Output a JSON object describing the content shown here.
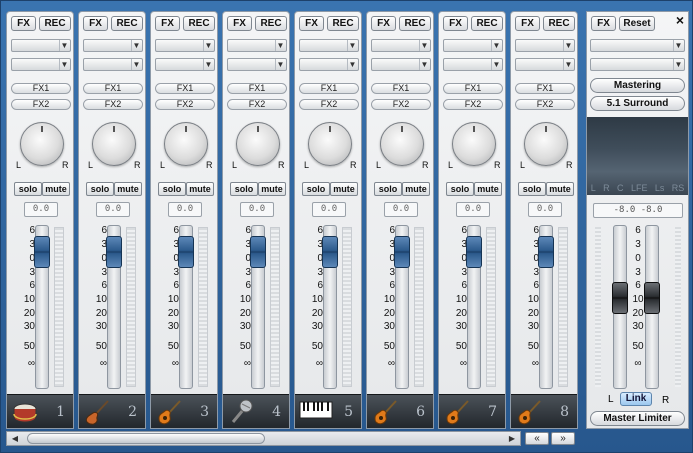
{
  "strip": {
    "fx_label": "FX",
    "rec_label": "REC",
    "fx1_label": "FX1",
    "fx2_label": "FX2",
    "pan_left": "L",
    "pan_right": "R",
    "solo_label": "solo",
    "mute_label": "mute",
    "gain_value": "0.0",
    "scale": [
      "6",
      "3",
      "0",
      "3",
      "6",
      "10",
      "20",
      "30",
      "50",
      "∞"
    ]
  },
  "channels": [
    {
      "number": "1",
      "instrument": "drum-icon",
      "fader_level_db": 0
    },
    {
      "number": "2",
      "instrument": "electric-guitar-icon",
      "fader_level_db": 0
    },
    {
      "number": "3",
      "instrument": "acoustic-guitar-icon",
      "fader_level_db": 0
    },
    {
      "number": "4",
      "instrument": "microphone-icon",
      "fader_level_db": 0
    },
    {
      "number": "5",
      "instrument": "keyboard-icon",
      "fader_level_db": 0
    },
    {
      "number": "6",
      "instrument": "acoustic-guitar-icon",
      "fader_level_db": 0
    },
    {
      "number": "7",
      "instrument": "acoustic-guitar-icon",
      "fader_level_db": 0
    },
    {
      "number": "8",
      "instrument": "acoustic-guitar-icon",
      "fader_level_db": 0
    }
  ],
  "master": {
    "fx_label": "FX",
    "reset_label": "Reset",
    "mastering_label": "Mastering",
    "surround_label": "5.1 Surround",
    "surround_channels": [
      "L",
      "R",
      "C",
      "LFE",
      "Ls",
      "RS"
    ],
    "gain_value": "-8.0  -8.0",
    "left_label": "L",
    "right_label": "R",
    "link_label": "Link",
    "limiter_label": "Master Limiter",
    "close_glyph": "×"
  },
  "scroll": {
    "left_arrow": "◀",
    "right_arrow": "▶",
    "prev_label": "«",
    "next_label": "»"
  },
  "colors": {
    "background": "#2b5f96",
    "fader_cap": "#2c5a8c",
    "master_fader_cap": "#2a2d31"
  }
}
